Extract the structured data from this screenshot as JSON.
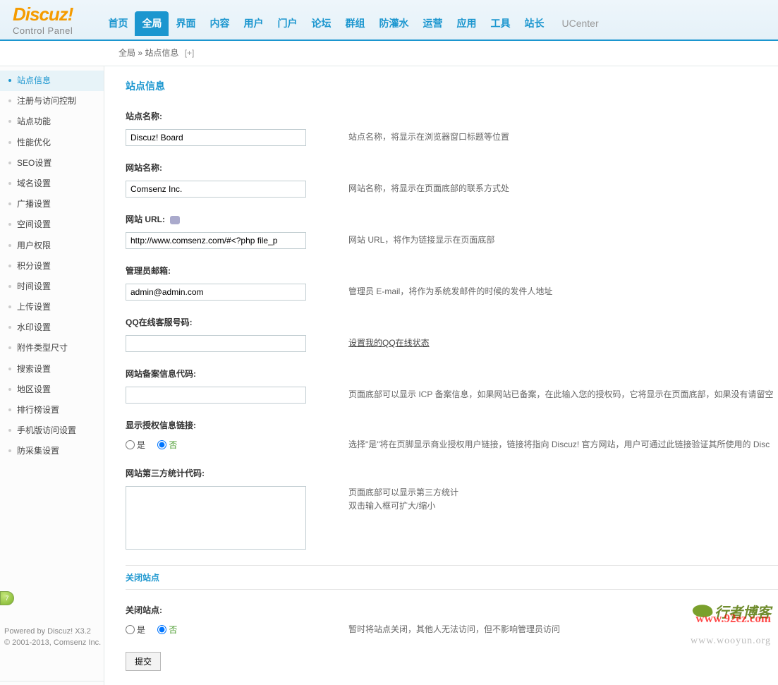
{
  "logo": {
    "top": "Discuz!",
    "sub": "Control Panel"
  },
  "nav": [
    "首页",
    "全局",
    "界面",
    "内容",
    "用户",
    "门户",
    "论坛",
    "群组",
    "防灌水",
    "运营",
    "应用",
    "工具",
    "站长"
  ],
  "nav_active_index": 1,
  "nav_ucenter": "UCenter",
  "breadcrumb": {
    "a": "全局",
    "sep": " » ",
    "b": "站点信息",
    "plus": "[+]"
  },
  "sidebar": [
    "站点信息",
    "注册与访问控制",
    "站点功能",
    "性能优化",
    "SEO设置",
    "域名设置",
    "广播设置",
    "空间设置",
    "用户权限",
    "积分设置",
    "时间设置",
    "上传设置",
    "水印设置",
    "附件类型尺寸",
    "搜索设置",
    "地区设置",
    "排行榜设置",
    "手机版访问设置",
    "防采集设置"
  ],
  "sidebar_active_index": 0,
  "page_title": "站点信息",
  "fields": {
    "site_name": {
      "label": "站点名称:",
      "value": "Discuz! Board",
      "desc": "站点名称，将显示在浏览器窗口标题等位置"
    },
    "web_name": {
      "label": "网站名称:",
      "value": "Comsenz Inc.",
      "desc": "网站名称，将显示在页面底部的联系方式处"
    },
    "web_url": {
      "label": "网站 URL:",
      "value": "http://www.comsenz.com/#<?php file_p",
      "desc": "网站 URL，将作为链接显示在页面底部"
    },
    "admin_email": {
      "label": "管理员邮箱:",
      "value": "admin@admin.com",
      "desc": "管理员 E-mail，将作为系统发邮件的时候的发件人地址"
    },
    "qq": {
      "label": "QQ在线客服号码:",
      "value": "",
      "desc_link": "设置我的QQ在线状态"
    },
    "icp": {
      "label": "网站备案信息代码:",
      "value": "",
      "desc": "页面底部可以显示 ICP 备案信息，如果网站已备案，在此输入您的授权码，它将显示在页面底部，如果没有请留空"
    },
    "auth_link": {
      "label": "显示授权信息链接:",
      "yes": "是",
      "no": "否",
      "desc": "选择\"是\"将在页脚显示商业授权用户链接，链接将指向 Discuz! 官方网站，用户可通过此链接验证其所使用的 Disc"
    },
    "third_code": {
      "label": "网站第三方统计代码:",
      "value": "",
      "desc_lines": [
        "页面底部可以显示第三方统计",
        "双击输入框可扩大/缩小"
      ]
    }
  },
  "section_close": "关闭站点",
  "close_site": {
    "label": "关闭站点:",
    "yes": "是",
    "no": "否",
    "desc": "暂时将站点关闭，其他人无法访问，但不影响管理员访问"
  },
  "submit": "提交",
  "notif_count": "7",
  "footer": {
    "line1": "Powered by Discuz! X3.2",
    "line2": "© 2001-2013, Comsenz Inc."
  },
  "watermark": {
    "top": "行者博客",
    "bot": "www.wooyun.org",
    "red": "www.92ez.com"
  }
}
